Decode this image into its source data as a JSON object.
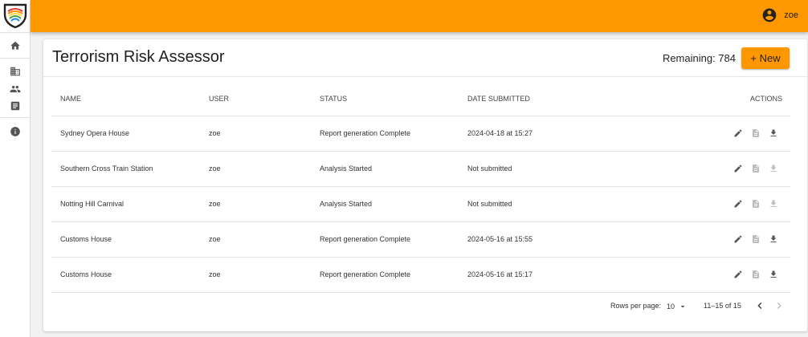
{
  "header": {
    "user_name": "zoe"
  },
  "page": {
    "title": "Terrorism Risk Assessor",
    "remaining_label": "Remaining: 784",
    "new_button_label": "+ New"
  },
  "table": {
    "columns": {
      "name": "NAME",
      "user": "USER",
      "status": "STATUS",
      "date": "DATE SUBMITTED",
      "actions": "ACTIONS"
    },
    "rows": [
      {
        "name": "Sydney Opera House",
        "user": "zoe",
        "status": "Report generation Complete",
        "date": "2024-04-18 at 15:27",
        "download_enabled": true
      },
      {
        "name": "Southern Cross Train Station",
        "user": "zoe",
        "status": "Analysis Started",
        "date": "Not submitted",
        "download_enabled": false
      },
      {
        "name": "Notting Hill Carnival",
        "user": "zoe",
        "status": "Analysis Started",
        "date": "Not submitted",
        "download_enabled": false
      },
      {
        "name": "Customs House",
        "user": "zoe",
        "status": "Report generation Complete",
        "date": "2024-05-16 at 15:55",
        "download_enabled": true
      },
      {
        "name": "Customs House",
        "user": "zoe",
        "status": "Report generation Complete",
        "date": "2024-05-16 at 15:17",
        "download_enabled": true
      }
    ]
  },
  "pagination": {
    "rows_per_page_label": "Rows per page:",
    "rows_per_page_value": "10",
    "range_label": "11–15 of 15"
  },
  "colors": {
    "accent": "#ff9800",
    "icon_active": "#555555",
    "icon_disabled": "#bdbdbd"
  },
  "icons": {
    "sidebar": [
      "home-icon",
      "business-icon",
      "people-icon",
      "article-icon",
      "info-icon"
    ],
    "actions": [
      "edit-icon",
      "report-icon",
      "download-icon"
    ]
  }
}
